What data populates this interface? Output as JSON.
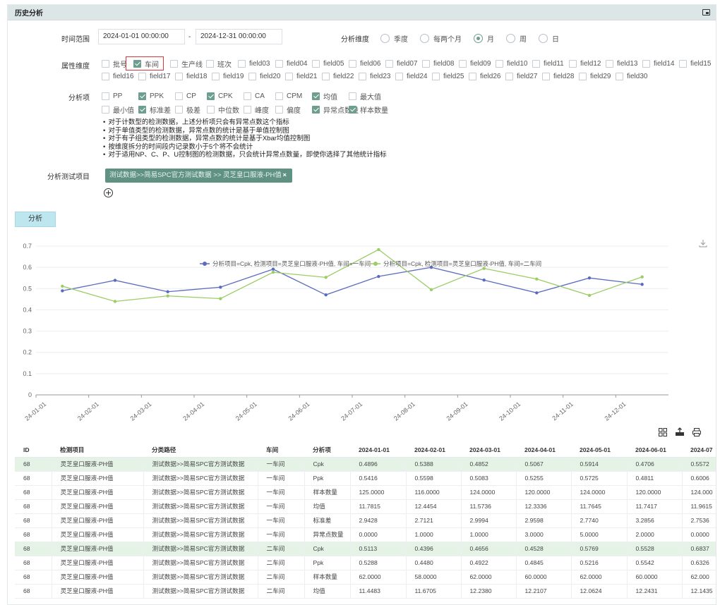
{
  "panel": {
    "title": "历史分析",
    "expand_icon": "expand-icon"
  },
  "time": {
    "label": "时间范围",
    "start": "2024-01-01 00:00:00",
    "separator": "-",
    "end": "2024-12-31 00:00:00"
  },
  "dimension": {
    "label": "分析维度",
    "options": [
      "季度",
      "每两个月",
      "月",
      "周",
      "日"
    ],
    "selected": "月"
  },
  "attributes": {
    "label": "属性维度",
    "row1": [
      {
        "label": "批号",
        "checked": false
      },
      {
        "label": "车间",
        "checked": true
      },
      {
        "label": "生产线",
        "checked": false
      },
      {
        "label": "班次",
        "checked": false
      },
      {
        "label": "field03",
        "checked": false
      },
      {
        "label": "field04",
        "checked": false
      },
      {
        "label": "field05",
        "checked": false
      },
      {
        "label": "field06",
        "checked": false
      },
      {
        "label": "field07",
        "checked": false
      },
      {
        "label": "field08",
        "checked": false
      },
      {
        "label": "field09",
        "checked": false
      },
      {
        "label": "field10",
        "checked": false
      },
      {
        "label": "field11",
        "checked": false
      },
      {
        "label": "field12",
        "checked": false
      },
      {
        "label": "field13",
        "checked": false
      },
      {
        "label": "field14",
        "checked": false
      },
      {
        "label": "field15",
        "checked": false
      }
    ],
    "row2": [
      {
        "label": "field16",
        "checked": false
      },
      {
        "label": "field17",
        "checked": false
      },
      {
        "label": "field18",
        "checked": false
      },
      {
        "label": "field19",
        "checked": false
      },
      {
        "label": "field20",
        "checked": false
      },
      {
        "label": "field21",
        "checked": false
      },
      {
        "label": "field22",
        "checked": false
      },
      {
        "label": "field23",
        "checked": false
      },
      {
        "label": "field24",
        "checked": false
      },
      {
        "label": "field25",
        "checked": false
      },
      {
        "label": "field26",
        "checked": false
      },
      {
        "label": "field27",
        "checked": false
      },
      {
        "label": "field28",
        "checked": false
      },
      {
        "label": "field29",
        "checked": false
      },
      {
        "label": "field30",
        "checked": false
      }
    ]
  },
  "items": {
    "label": "分析项",
    "row1": [
      {
        "label": "PP",
        "checked": false
      },
      {
        "label": "PPK",
        "checked": true
      },
      {
        "label": "CP",
        "checked": false
      },
      {
        "label": "CPK",
        "checked": true
      },
      {
        "label": "CA",
        "checked": false
      },
      {
        "label": "CPM",
        "checked": false
      },
      {
        "label": "均值",
        "checked": true
      },
      {
        "label": "最大值",
        "checked": false
      }
    ],
    "row2": [
      {
        "label": "最小值",
        "checked": false
      },
      {
        "label": "标准差",
        "checked": true
      },
      {
        "label": "极差",
        "checked": false
      },
      {
        "label": "中位数",
        "checked": false
      },
      {
        "label": "峰度",
        "checked": false
      },
      {
        "label": "偏度",
        "checked": false
      },
      {
        "label": "异常点数量",
        "checked": true
      },
      {
        "label": "样本数量",
        "checked": true
      }
    ]
  },
  "notes": [
    "对于计数型的检测数据，上述分析项只会有异常点数这个指标",
    "对于单值类型的检测数据，异常点数的统计是基于单值控制图",
    "对于有子组类型的检测数据，异常点数的统计是基于Xbar均值控制图",
    "按维度拆分的时间段内记录数小于5个将不会统计",
    "对于适用NP、C、P、U控制图的检测数据，只会统计异常点数量，即使你选择了其他统计指标"
  ],
  "test_item": {
    "label": "分析测试项目",
    "tag": "测试数据>>简易SPC官方测试数据 >> 灵芝皇口服液-PH值",
    "close": "×"
  },
  "analyze_button": "分析",
  "chart_data": {
    "type": "line",
    "categories": [
      "2024-01-01",
      "2024-02-01",
      "2024-03-01",
      "2024-04-01",
      "2024-05-01",
      "2024-06-01",
      "2024-07-01",
      "2024-08-01",
      "2024-09-01",
      "2024-10-01",
      "2024-11-01",
      "2024-12-01"
    ],
    "tick_labels": [
      "24-01-01",
      "24-02-01",
      "24-03-01",
      "24-04-01",
      "24-05-01",
      "24-06-01",
      "24-07-01",
      "24-08-01",
      "24-09-01",
      "24-10-01",
      "24-11-01",
      "24-12-01"
    ],
    "ylim": [
      0,
      0.7
    ],
    "yticks": [
      "0",
      "0.1",
      "0.2",
      "0.3",
      "0.4",
      "0.5",
      "0.6",
      "0.7"
    ],
    "legend_position": "top",
    "series": [
      {
        "name": "分析项目=Cpk, 检测项目=灵芝皇口服液-PH值, 车间=一车间",
        "color": "#5b6bc0",
        "values": [
          0.4896,
          0.5388,
          0.4852,
          0.5067,
          0.5914,
          0.4706,
          0.5572,
          0.6,
          0.54,
          0.48,
          0.55,
          0.52
        ]
      },
      {
        "name": "分析项目=Cpk, 检测项目=灵芝皇口服液-PH值, 车间=二车间",
        "color": "#9ccc65",
        "values": [
          0.5113,
          0.4396,
          0.4656,
          0.4528,
          0.5769,
          0.5528,
          0.6837,
          0.495,
          0.595,
          0.545,
          0.468,
          0.555
        ]
      }
    ]
  },
  "toolbar_icons": [
    "grid-icon",
    "export-icon",
    "print-icon"
  ],
  "table": {
    "columns": [
      "ID",
      "检测项目",
      "分类路径",
      "车间",
      "分析项",
      "2024-01-01",
      "2024-02-01",
      "2024-03-01",
      "2024-04-01",
      "2024-05-01",
      "2024-06-01",
      "2024-07"
    ],
    "rows": [
      [
        "68",
        "灵芝皇口服液-PH值",
        "测试数据>>简易SPC官方测试数据",
        "一车间",
        "Cpk",
        "0.4896",
        "0.5388",
        "0.4852",
        "0.5067",
        "0.5914",
        "0.4706",
        "0.5572"
      ],
      [
        "68",
        "灵芝皇口服液-PH值",
        "测试数据>>简易SPC官方测试数据",
        "一车间",
        "Ppk",
        "0.5416",
        "0.5598",
        "0.5083",
        "0.5255",
        "0.5725",
        "0.4811",
        "0.6006"
      ],
      [
        "68",
        "灵芝皇口服液-PH值",
        "测试数据>>简易SPC官方测试数据",
        "一车间",
        "样本数量",
        "125.0000",
        "116.0000",
        "124.0000",
        "120.0000",
        "124.0000",
        "120.0000",
        "124.000"
      ],
      [
        "68",
        "灵芝皇口服液-PH值",
        "测试数据>>简易SPC官方测试数据",
        "一车间",
        "均值",
        "11.7815",
        "12.4454",
        "11.5736",
        "12.3336",
        "11.7645",
        "11.7417",
        "11.9615"
      ],
      [
        "68",
        "灵芝皇口服液-PH值",
        "测试数据>>简易SPC官方测试数据",
        "一车间",
        "标准差",
        "2.9428",
        "2.7121",
        "2.9994",
        "2.9598",
        "2.7740",
        "3.2856",
        "2.7536"
      ],
      [
        "68",
        "灵芝皇口服液-PH值",
        "测试数据>>简易SPC官方测试数据",
        "一车间",
        "异常点数量",
        "0.0000",
        "1.0000",
        "1.0000",
        "3.0000",
        "5.0000",
        "2.0000",
        "0.0000"
      ],
      [
        "68",
        "灵芝皇口服液-PH值",
        "测试数据>>简易SPC官方测试数据",
        "二车间",
        "Cpk",
        "0.5113",
        "0.4396",
        "0.4656",
        "0.4528",
        "0.5769",
        "0.5528",
        "0.6837"
      ],
      [
        "68",
        "灵芝皇口服液-PH值",
        "测试数据>>简易SPC官方测试数据",
        "二车间",
        "Ppk",
        "0.5288",
        "0.4480",
        "0.4922",
        "0.4845",
        "0.5216",
        "0.5542",
        "0.6326"
      ],
      [
        "68",
        "灵芝皇口服液-PH值",
        "测试数据>>简易SPC官方测试数据",
        "二车间",
        "样本数量",
        "62.0000",
        "58.0000",
        "62.0000",
        "60.0000",
        "62.0000",
        "60.0000",
        "62.000"
      ],
      [
        "68",
        "灵芝皇口服液-PH值",
        "测试数据>>简易SPC官方测试数据",
        "二车间",
        "均值",
        "11.4483",
        "11.6705",
        "12.2380",
        "12.2107",
        "12.0624",
        "12.2431",
        "12.1435"
      ]
    ],
    "highlight_rows": [
      0,
      6
    ]
  }
}
